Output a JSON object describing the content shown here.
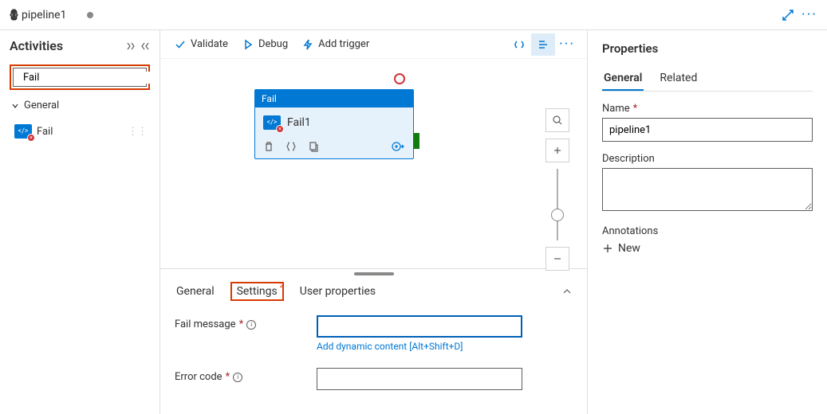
{
  "header": {
    "tab_title": "pipeline1",
    "pipeline_icon_text": "{[]}"
  },
  "sidebar": {
    "title": "Activities",
    "search_value": "Fail",
    "category": "General",
    "item": "Fail"
  },
  "toolbar": {
    "validate": "Validate",
    "debug": "Debug",
    "add_trigger": "Add trigger"
  },
  "canvas": {
    "node_type": "Fail",
    "node_name": "Fail1"
  },
  "bottom_tabs": {
    "general": "General",
    "settings": "Settings",
    "settings_badge": "2",
    "user_props": "User properties"
  },
  "form": {
    "fail_msg_label": "Fail message",
    "dyn_content": "Add dynamic content [Alt+Shift+D]",
    "error_code_label": "Error code",
    "fail_msg_value": "",
    "error_code_value": ""
  },
  "rpanel": {
    "title": "Properties",
    "tab_general": "General",
    "tab_related": "Related",
    "name_label": "Name",
    "name_value": "pipeline1",
    "desc_label": "Description",
    "annotations_label": "Annotations",
    "new_label": "New"
  }
}
